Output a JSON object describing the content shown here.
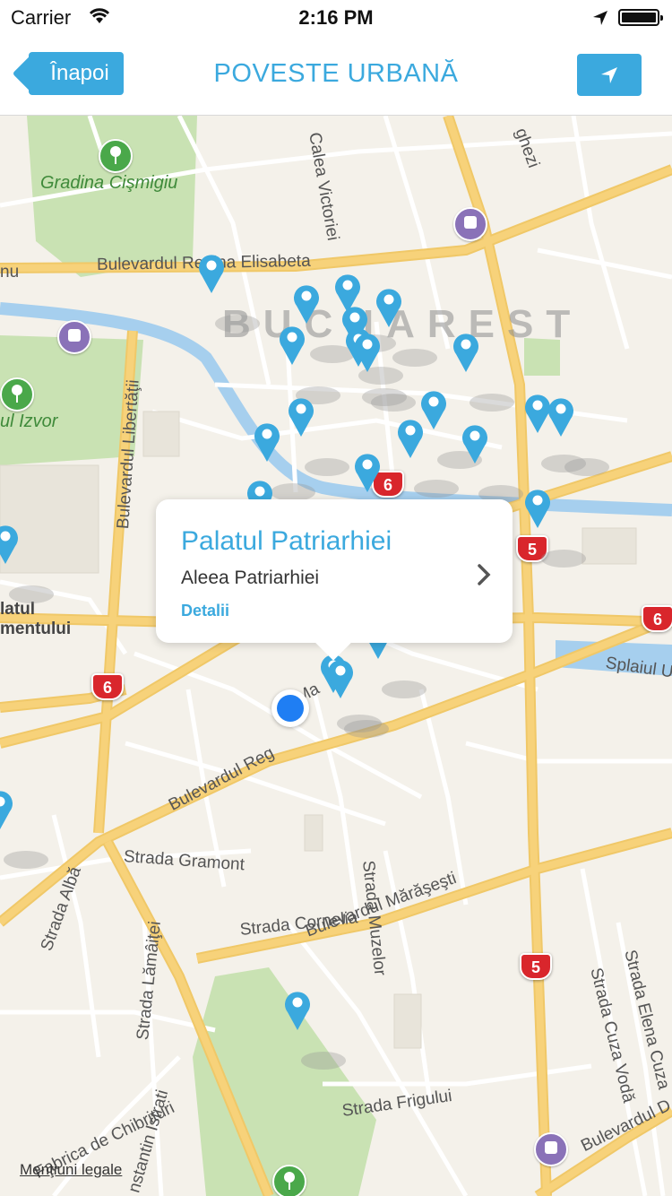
{
  "status_bar": {
    "carrier": "Carrier",
    "time": "2:16 PM"
  },
  "nav": {
    "back_label": "Înapoi",
    "title": "POVESTE URBANĂ",
    "locate_icon": "location-arrow-icon"
  },
  "map": {
    "city_label": "BUCHAREST",
    "labels": {
      "gradina": "Gradina Cişmigiu",
      "izvor": "ul Izvor",
      "regina": "Bulevardul Regina Elisabeta",
      "victoriei": "Calea Victoriei",
      "libertatii": "Bulevardul Libertăţii",
      "splaiul": "Splaiul Uni",
      "bulevardul_reg": "Bulevardul Reg",
      "gramont": "Strada Gramont",
      "muzelor": "Strada Muzelor",
      "cornelia": "Strada Cornelia",
      "marasesti": "Bulevardul Mărăşeşti",
      "alba": "Strada Albă",
      "lamaitei": "Strada Lămâiţei",
      "chibrituri": "Fabrica de Chibrituri",
      "istrati": "nstantin Istrati",
      "frigului": "Strada Frigului",
      "cuza": "Strada Cuza Vodă",
      "elena": "Strada Elena Cuza",
      "bulevardul_d": "Bulevardul D",
      "palatul": "latul",
      "mentului": "mentului",
      "nu": "nu",
      "ghezi": "ghezi",
      "ma": "Ma"
    },
    "route_shields": [
      "6",
      "5",
      "6",
      "6",
      "5"
    ]
  },
  "callout": {
    "title": "Palatul Patriarhiei",
    "subtitle": "Aleea Patriarhiei",
    "link": "Detalii"
  },
  "legal": "Menţiuni legale",
  "colors": {
    "accent": "#3ba9de",
    "user_location": "#1f7ef3",
    "park": "#c9e2b3",
    "water": "#a6cfee",
    "major_road": "#f7d27a",
    "shield": "#d9262c"
  }
}
